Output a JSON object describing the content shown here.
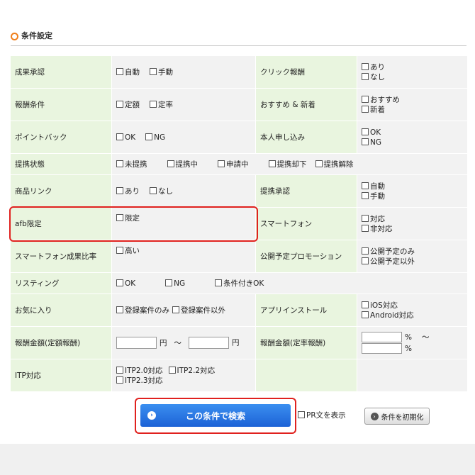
{
  "section_title": "条件設定",
  "rows": {
    "r1": {
      "label": "成果承認",
      "opts": [
        "自動",
        "手動"
      ],
      "label2": "クリック報酬",
      "opts2": [
        "あり",
        "なし"
      ]
    },
    "r2": {
      "label": "報酬条件",
      "opts": [
        "定額",
        "定率"
      ],
      "label2": "おすすめ & 新着",
      "opts2": [
        "おすすめ",
        "新着"
      ]
    },
    "r3": {
      "label": "ポイントバック",
      "opts": [
        "OK",
        "NG"
      ],
      "label2": "本人申し込み",
      "opts2": [
        "OK",
        "NG"
      ]
    },
    "r4": {
      "label": "提携状態",
      "opts": [
        "未提携",
        "提携中",
        "申請中",
        "提携却下",
        "提携解除"
      ]
    },
    "r5": {
      "label": "商品リンク",
      "opts": [
        "あり",
        "なし"
      ],
      "label2": "提携承認",
      "opts2": [
        "自動",
        "手動"
      ]
    },
    "r6": {
      "label": "afb限定",
      "opts": [
        "限定"
      ],
      "label2": "スマートフォン",
      "opts2": [
        "対応",
        "非対応"
      ]
    },
    "r7": {
      "label": "スマートフォン成果比率",
      "opts": [
        "高い"
      ],
      "label2": "公開予定プロモーション",
      "opts2": [
        "公開予定のみ",
        "公開予定以外"
      ]
    },
    "r8": {
      "label": "リスティング",
      "opts": [
        "OK",
        "NG",
        "条件付きOK"
      ]
    },
    "r9": {
      "label": "お気に入り",
      "opts": [
        "登録案件のみ",
        "登録案件以外"
      ],
      "label2": "アプリインストール",
      "opts2": [
        "iOS対応",
        "Android対応"
      ]
    },
    "r10": {
      "label": "報酬金額(定額報酬)",
      "yen": "円",
      "tilde": "〜",
      "label2": "報酬金額(定率報酬)",
      "pct": "%"
    },
    "r11": {
      "label": "ITP対応",
      "opts": [
        "ITP2.0対応",
        "ITP2.2対応",
        "ITP2.3対応"
      ]
    }
  },
  "buttons": {
    "search": "この条件で検索",
    "pr_text": "PR文を表示",
    "reset": "条件を初期化"
  },
  "colors": {
    "label_bg": "#e9f5df",
    "value_bg": "#f2f2f2",
    "highlight": "#e0211e",
    "search_btn": "#1c62d6",
    "accent": "#f07f1b"
  },
  "icons": {
    "section": "circle-icon",
    "button_arrow": "chevron-right-circle-icon"
  }
}
